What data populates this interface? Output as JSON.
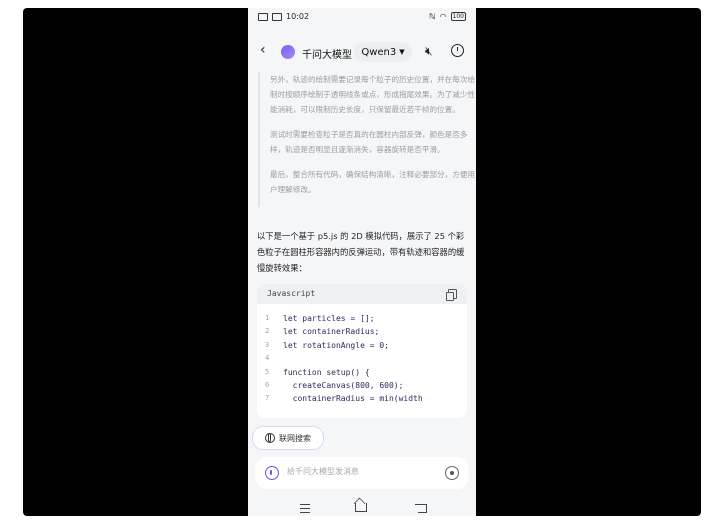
{
  "status_bar": {
    "time": "10:02",
    "battery": "100"
  },
  "header": {
    "title": "千问大模型",
    "model": "Qwen3"
  },
  "thinking": [
    "另外，轨迹的绘制需要记录每个粒子的历史位置，并在每次绘制时按顺序绘制于透明线条或点，形成拖尾效果。为了减少性能消耗，可以限制历史长度，只保留最近若干帧的位置。",
    "测试时需要检查粒子是否真的在圆柱内部反弹，颜色是否多样，轨迹是否明显且逐渐消失，容器旋转是否平滑。",
    "最后，整合所有代码，确保结构清晰，注释必要部分，方便用户理解修改。"
  ],
  "answer": "以下是一个基于 p5.js 的 2D 模拟代码，展示了 25 个彩色粒子在圆柱形容器内的反弹运动，带有轨迹和容器的缓慢旋转效果：",
  "code": {
    "language": "Javascript",
    "lines": [
      {
        "n": "1",
        "text": "let particles = [];"
      },
      {
        "n": "2",
        "text": "let containerRadius;"
      },
      {
        "n": "3",
        "text": "let rotationAngle = 0;"
      },
      {
        "n": "4",
        "text": ""
      },
      {
        "n": "5",
        "text": "function setup() {"
      },
      {
        "n": "6",
        "text": "  createCanvas(800, 600);"
      },
      {
        "n": "7",
        "text": "  containerRadius = min(width"
      }
    ]
  },
  "web_search": {
    "label": "联网搜索"
  },
  "input": {
    "placeholder": "给千问大模型发消息"
  }
}
